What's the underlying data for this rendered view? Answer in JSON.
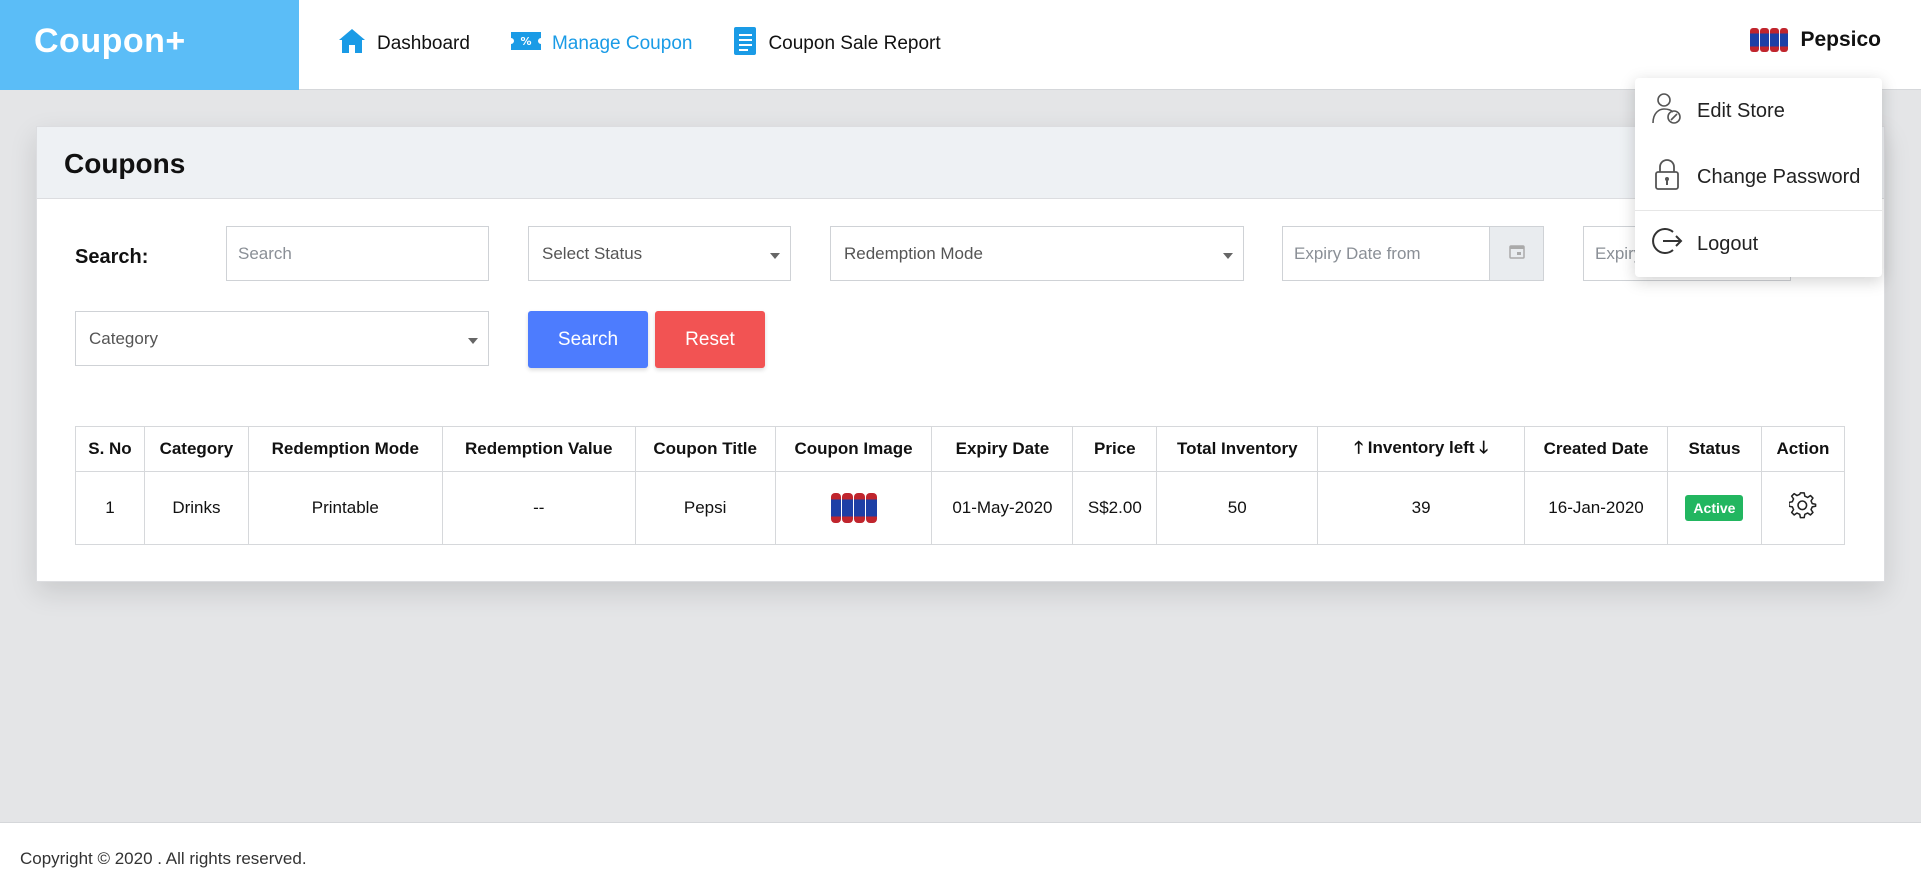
{
  "app": {
    "logo": "Coupon+"
  },
  "nav": {
    "items": [
      {
        "label": "Dashboard",
        "icon": "home-icon",
        "active": false
      },
      {
        "label": "Manage Coupon",
        "icon": "coupon-icon",
        "active": true
      },
      {
        "label": "Coupon Sale Report",
        "icon": "report-icon",
        "active": false
      }
    ]
  },
  "user": {
    "name": "Pepsico"
  },
  "user_menu": {
    "edit_store": "Edit Store",
    "change_password": "Change Password",
    "logout": "Logout"
  },
  "page": {
    "title": "Coupons"
  },
  "filters": {
    "search_label": "Search:",
    "search_placeholder": "Search",
    "status_placeholder": "Select Status",
    "redemption_placeholder": "Redemption Mode",
    "expiry_from_placeholder": "Expiry Date from",
    "expiry_to_placeholder": "Expiry",
    "category_placeholder": "Category",
    "search_button": "Search",
    "reset_button": "Reset"
  },
  "table": {
    "headers": {
      "sno": "S. No",
      "category": "Category",
      "redemption_mode": "Redemption Mode",
      "redemption_value": "Redemption Value",
      "coupon_title": "Coupon Title",
      "coupon_image": "Coupon Image",
      "expiry_date": "Expiry Date",
      "price": "Price",
      "total_inventory": "Total Inventory",
      "inventory_left": "Inventory left",
      "created_date": "Created Date",
      "status": "Status",
      "action": "Action"
    },
    "rows": [
      {
        "sno": "1",
        "category": "Drinks",
        "redemption_mode": "Printable",
        "redemption_value": "--",
        "coupon_title": "Pepsi",
        "expiry_date": "01-May-2020",
        "price": "S$2.00",
        "total_inventory": "50",
        "inventory_left": "39",
        "created_date": "16-Jan-2020",
        "status": "Active"
      }
    ]
  },
  "footer": {
    "copyright": "Copyright © 2020 . All rights reserved."
  },
  "colors": {
    "brand": "#5bbdf7",
    "active_nav": "#1a9be6",
    "search_button": "#4d7cfe",
    "reset_button": "#f25353",
    "status_active": "#22b660"
  }
}
